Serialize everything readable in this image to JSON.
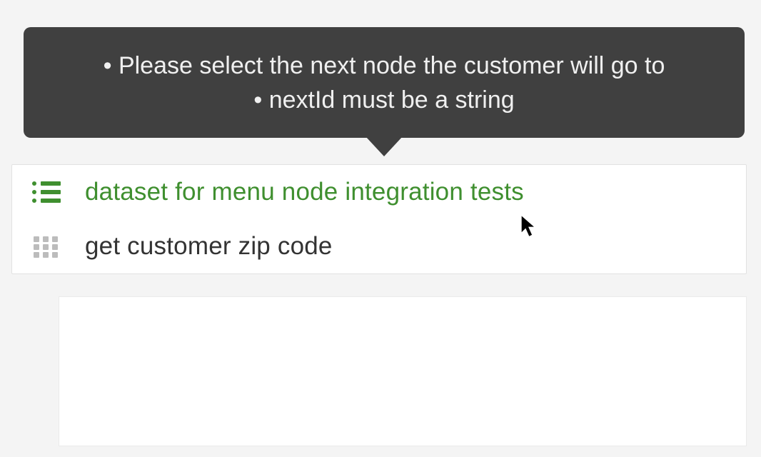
{
  "tooltip": {
    "messages": [
      "Please select the next node the customer will go to",
      "nextId must be a string"
    ]
  },
  "items": [
    {
      "label": "dataset for menu node integration tests",
      "icon": "list",
      "active": true
    },
    {
      "label": "get customer zip code",
      "icon": "grid",
      "active": false
    }
  ],
  "colors": {
    "accent": "#3f8f2f",
    "muted": "#bcbcbc",
    "tooltip_bg": "#404040"
  }
}
